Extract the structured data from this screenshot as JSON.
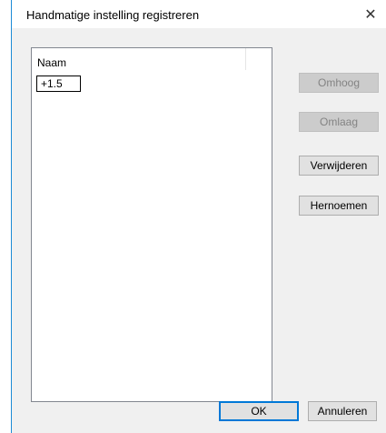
{
  "dialog": {
    "title": "Handmatige instelling registreren",
    "close_icon": "close-icon"
  },
  "list": {
    "column_header": "Naam",
    "edit_value": "+1.5"
  },
  "buttons": {
    "up": "Omhoog",
    "down": "Omlaag",
    "delete": "Verwijderen",
    "rename": "Hernoemen",
    "ok": "OK",
    "cancel": "Annuleren"
  },
  "colors": {
    "accent": "#0078d7",
    "window_border": "#1c8bd6",
    "client_bg": "#f0f0f0"
  }
}
